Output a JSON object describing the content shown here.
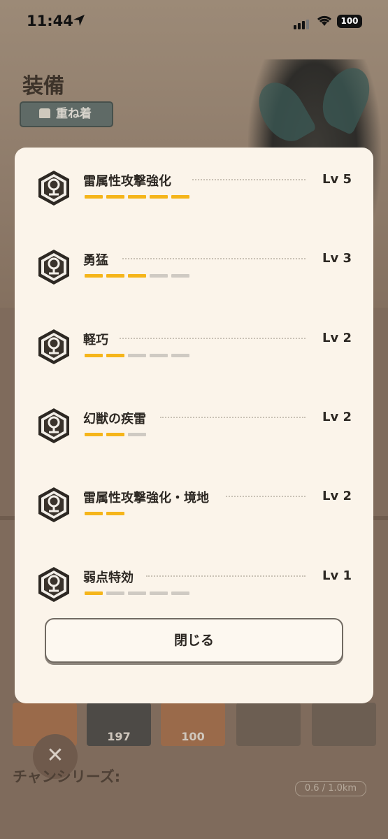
{
  "status_bar": {
    "time": "11:44",
    "battery": "100"
  },
  "background": {
    "page_title": "装備",
    "layer_button": "重ね着",
    "series_label": "チャンシリーズ:",
    "distance": "0.6 / 1.0km",
    "card_values": [
      "197",
      "100"
    ]
  },
  "skills": [
    {
      "name": "雷属性攻撃強化",
      "level": "Lv 5",
      "filled": 5,
      "total": 5
    },
    {
      "name": "勇猛",
      "level": "Lv 3",
      "filled": 3,
      "total": 5
    },
    {
      "name": "軽巧",
      "level": "Lv 2",
      "filled": 2,
      "total": 5
    },
    {
      "name": "幻獣の疾雷",
      "level": "Lv 2",
      "filled": 2,
      "total": 3
    },
    {
      "name": "雷属性攻撃強化・境地",
      "level": "Lv 2",
      "filled": 2,
      "total": 2
    },
    {
      "name": "弱点特効",
      "level": "Lv 1",
      "filled": 1,
      "total": 5
    }
  ],
  "close_button": "閉じる",
  "colors": {
    "bar_filled": "#f5b51a",
    "bar_empty": "#cfcac3",
    "modal_bg": "#fbf4ea"
  },
  "icons": [
    "location-arrow-icon",
    "signal-icon",
    "wifi-icon",
    "battery-icon",
    "skill-hexagon-icon",
    "shirt-icon",
    "close-x-icon"
  ]
}
